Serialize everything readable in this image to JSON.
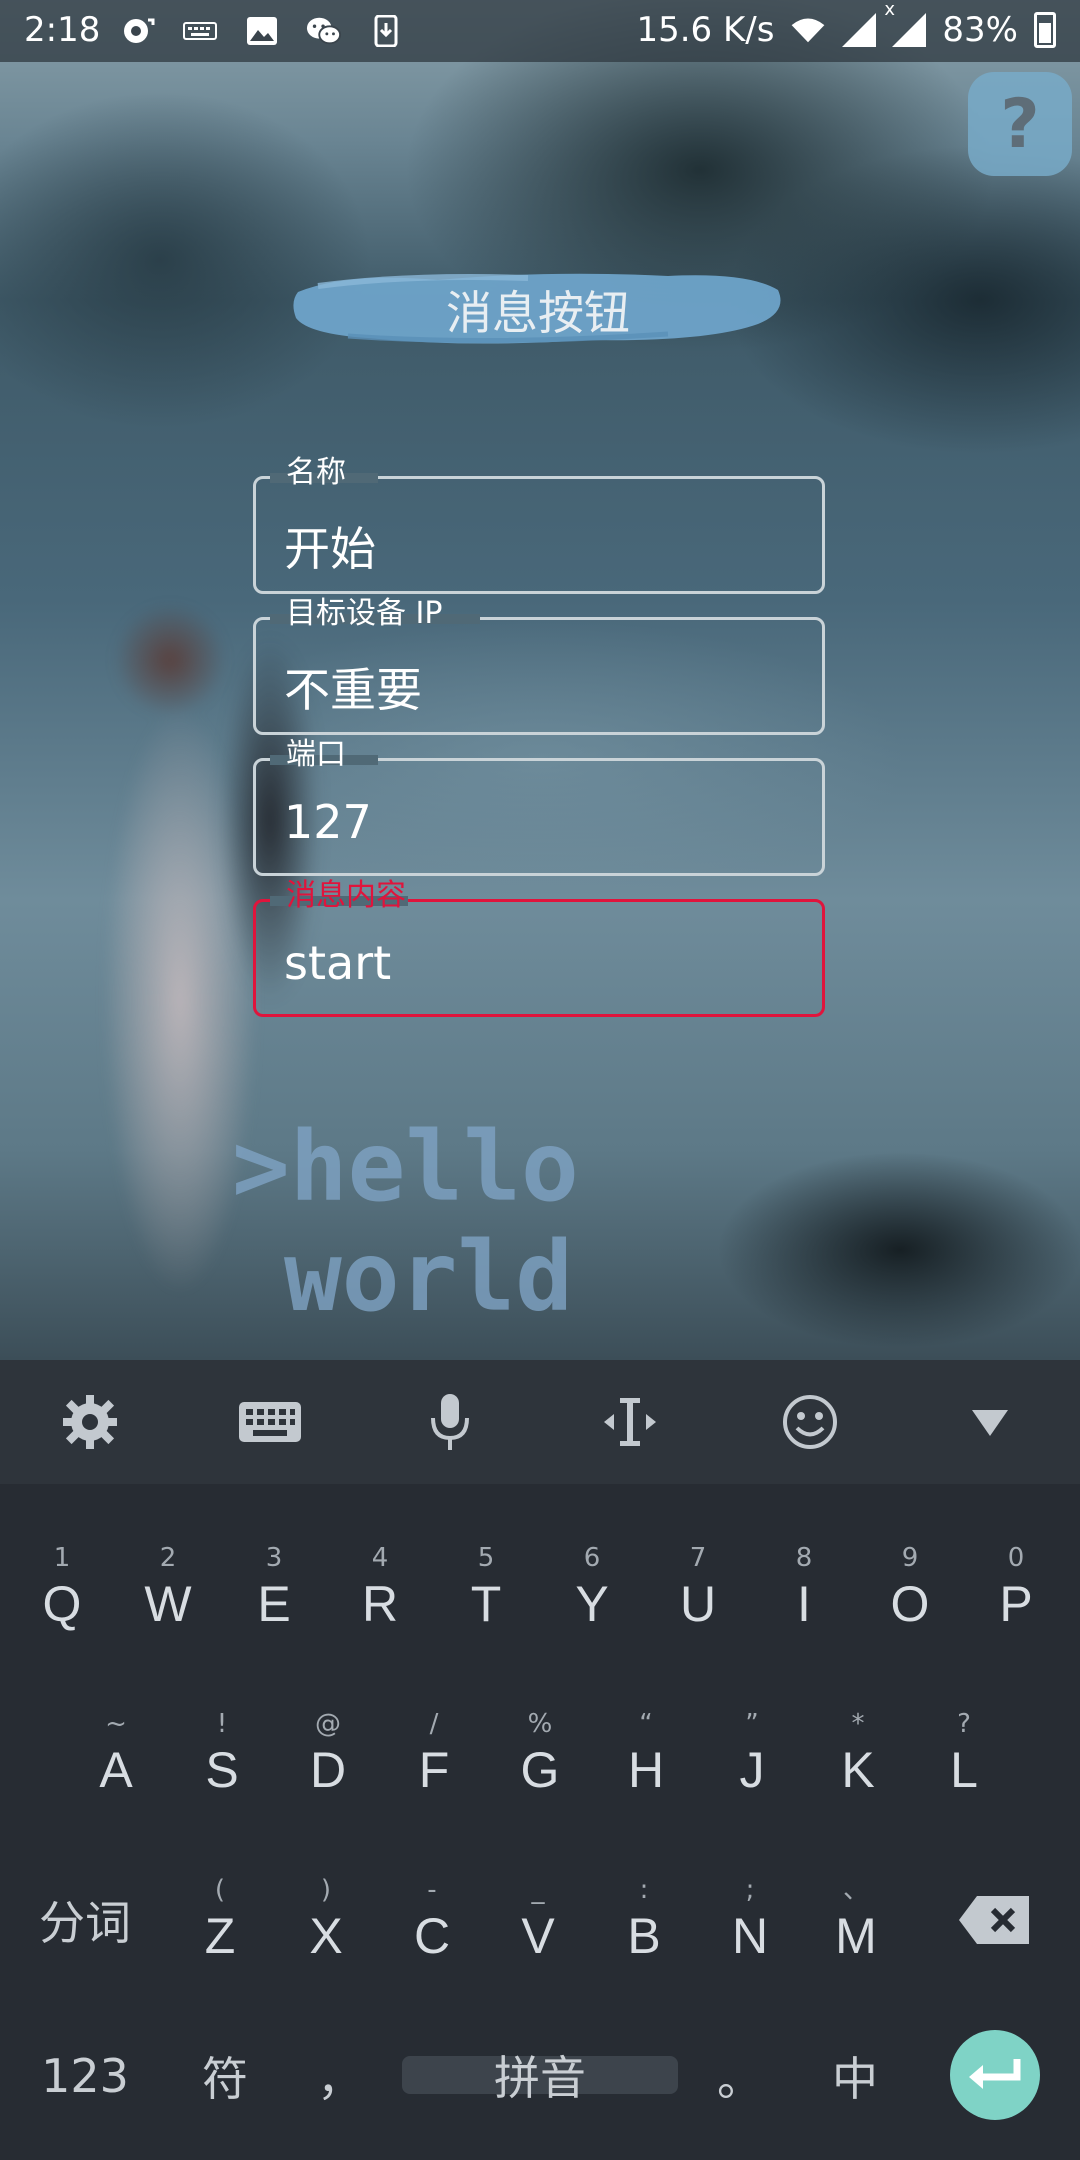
{
  "status_bar": {
    "time": "2:18",
    "network_speed": "15.6 K/s",
    "battery": "83%",
    "icons_left": [
      "sync-icon",
      "keyboard-notify-icon",
      "image-icon",
      "wechat-icon",
      "download-icon"
    ],
    "icons_right": [
      "wifi-icon",
      "signal-icon",
      "signal-x-icon",
      "battery-icon"
    ]
  },
  "help": {
    "label": "?"
  },
  "title": "消息按钮",
  "fields": [
    {
      "label": "名称",
      "value": "开始",
      "active": false
    },
    {
      "label": "目标设备 IP",
      "value": "不重要",
      "active": false
    },
    {
      "label": "端口",
      "value": "127",
      "active": false
    },
    {
      "label": "消息内容",
      "value": "start",
      "active": true
    }
  ],
  "decor_text": {
    "line1": ">hello",
    "line2": "world"
  },
  "keyboard": {
    "toolbar": [
      "gear-icon",
      "keyboard-icon",
      "mic-icon",
      "cursor-move-icon",
      "emoji-icon",
      "hide-keyboard-icon"
    ],
    "row1": [
      {
        "hint": "1",
        "key": "Q"
      },
      {
        "hint": "2",
        "key": "W"
      },
      {
        "hint": "3",
        "key": "E"
      },
      {
        "hint": "4",
        "key": "R"
      },
      {
        "hint": "5",
        "key": "T"
      },
      {
        "hint": "6",
        "key": "Y"
      },
      {
        "hint": "7",
        "key": "U"
      },
      {
        "hint": "8",
        "key": "I"
      },
      {
        "hint": "9",
        "key": "O"
      },
      {
        "hint": "0",
        "key": "P"
      }
    ],
    "row2": [
      {
        "hint": "~",
        "key": "A"
      },
      {
        "hint": "!",
        "key": "S"
      },
      {
        "hint": "@",
        "key": "D"
      },
      {
        "hint": "/",
        "key": "F"
      },
      {
        "hint": "%",
        "key": "G"
      },
      {
        "hint": "“",
        "key": "H"
      },
      {
        "hint": "”",
        "key": "J"
      },
      {
        "hint": "*",
        "key": "K"
      },
      {
        "hint": "?",
        "key": "L"
      }
    ],
    "row3": [
      {
        "hint": "(",
        "key": "Z"
      },
      {
        "hint": ")",
        "key": "X"
      },
      {
        "hint": "-",
        "key": "C"
      },
      {
        "hint": "_",
        "key": "V"
      },
      {
        "hint": ":",
        "key": "B"
      },
      {
        "hint": ";",
        "key": "N"
      },
      {
        "hint": "、",
        "key": "M"
      }
    ],
    "segment_key": "分词",
    "num_key": "123",
    "symbol_key": "符",
    "comma_key": "，",
    "space_label": "拼音",
    "period_key": "。",
    "lang_key": "中"
  }
}
